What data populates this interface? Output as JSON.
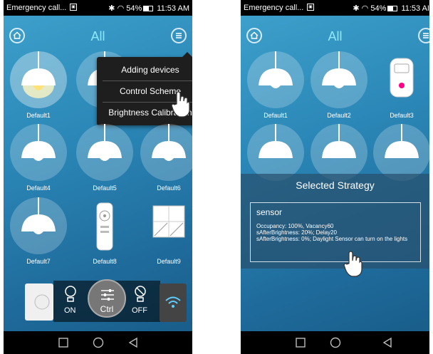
{
  "status_bar": {
    "title": "Emergency call...",
    "time": "11:53 AM",
    "time_right": "11:53 AI",
    "battery": "54%"
  },
  "header": {
    "title": "All"
  },
  "menu": {
    "items": [
      "Adding devices",
      "Control Scheme",
      "Brightness Calibration"
    ]
  },
  "devices_left": [
    {
      "label": "Default1"
    },
    {
      "label": "Default4"
    },
    {
      "label": "Default5"
    },
    {
      "label": "Default6"
    },
    {
      "label": "Default7"
    },
    {
      "label": "Default8"
    },
    {
      "label": "Default9"
    }
  ],
  "devices_right": [
    {
      "label": "Default1"
    },
    {
      "label": "Default2"
    },
    {
      "label": "Default3"
    }
  ],
  "control_bar": {
    "on_label": "ON",
    "ctrl_label": "Ctrl",
    "off_label": "OFF"
  },
  "strategy": {
    "heading": "Selected Strategy",
    "name": "sensor",
    "lines": [
      "Occupancy: 100%, Vacancy60",
      "sAfterBrightness: 20%; Delay20",
      "sAfterBrightness: 0%; Daylight Sensor can turn on the lights"
    ]
  },
  "colors": {
    "accent": "#8ee8ff",
    "menu_bg": "#1e1e1e",
    "background": "#2a86b6"
  },
  "icons": [
    "home-icon",
    "menu-icon",
    "lamp-icon",
    "remote-icon",
    "switch-panel-icon",
    "bulb-on-icon",
    "bulb-off-icon",
    "sliders-icon",
    "wifi-icon",
    "hand-pointer-icon",
    "nav-square-icon",
    "nav-circle-icon",
    "nav-back-icon"
  ]
}
